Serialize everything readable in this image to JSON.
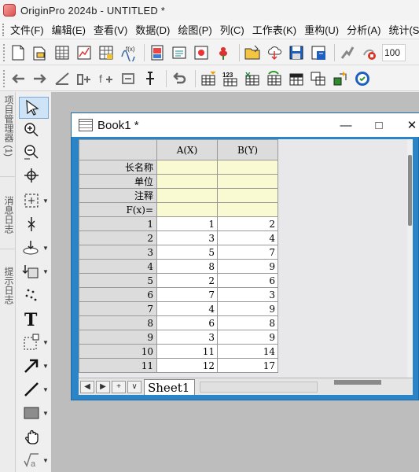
{
  "window": {
    "title": "OriginPro 2024b - UNTITLED *"
  },
  "menubar": {
    "items": [
      "文件(F)",
      "编辑(E)",
      "查看(V)",
      "数据(D)",
      "绘图(P)",
      "列(C)",
      "工作表(K)",
      "重构(U)",
      "分析(A)",
      "统计(S)"
    ]
  },
  "toolbar1": {
    "zoom_value": "100"
  },
  "side_panel": {
    "tabs": [
      "项目管理器 (1)",
      "消息日志",
      "提示日志"
    ]
  },
  "book": {
    "title": "Book1 *",
    "columns": [
      "A(X)",
      "B(Y)"
    ],
    "meta_rows": [
      "长名称",
      "单位",
      "注释",
      "F(x)="
    ],
    "rows": [
      {
        "index": "1",
        "a": "1",
        "b": "2"
      },
      {
        "index": "2",
        "a": "3",
        "b": "4"
      },
      {
        "index": "3",
        "a": "5",
        "b": "7"
      },
      {
        "index": "4",
        "a": "8",
        "b": "9"
      },
      {
        "index": "5",
        "a": "2",
        "b": "6"
      },
      {
        "index": "6",
        "a": "7",
        "b": "3"
      },
      {
        "index": "7",
        "a": "4",
        "b": "9"
      },
      {
        "index": "8",
        "a": "6",
        "b": "8"
      },
      {
        "index": "9",
        "a": "3",
        "b": "9"
      },
      {
        "index": "10",
        "a": "11",
        "b": "14"
      },
      {
        "index": "11",
        "a": "12",
        "b": "17"
      }
    ],
    "sheet_tab": "Sheet1"
  },
  "colors": {
    "window_frame": "#2b84c6",
    "meta_cell": "#fafad2",
    "header_cell": "#dcdcdc",
    "workspace": "#bdbdbd"
  }
}
